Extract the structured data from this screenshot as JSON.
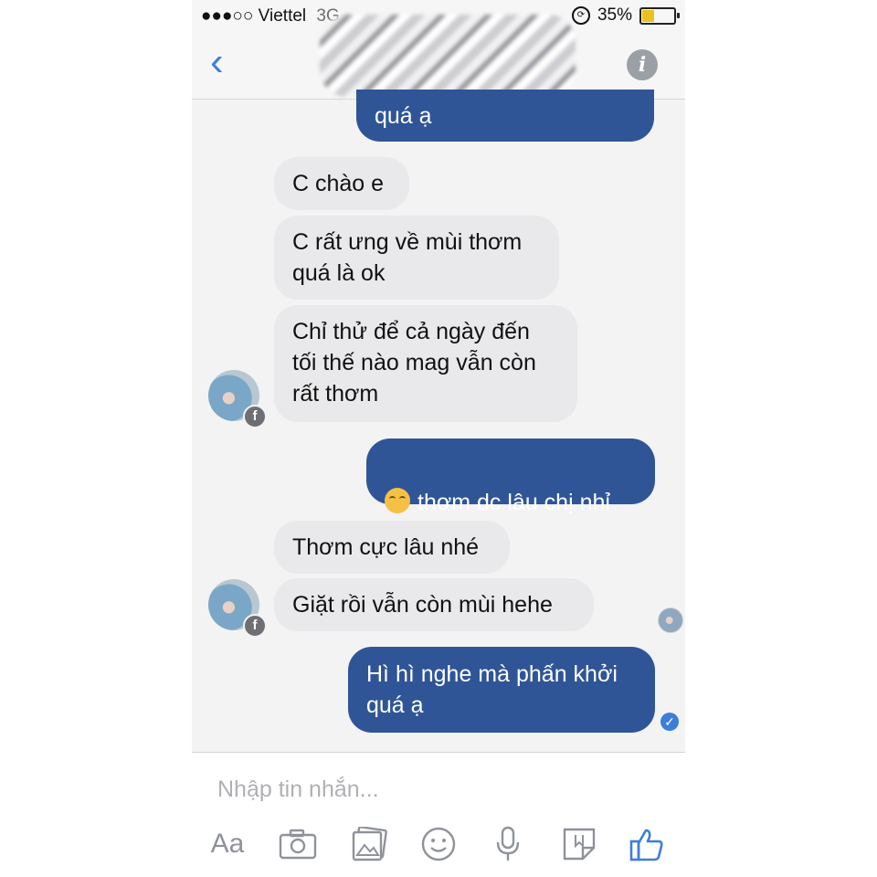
{
  "status_bar": {
    "signal": "●●●○○",
    "carrier": "Viettel",
    "network": "3G",
    "battery_percent": "35%",
    "battery_level": 0.35
  },
  "header": {
    "back_icon": "chevron-left-icon",
    "info_icon": "info-icon",
    "info_glyph": "i"
  },
  "messages": [
    {
      "side": "out",
      "text": "quá ạ"
    },
    {
      "side": "in",
      "text": "C chào e"
    },
    {
      "side": "in",
      "text": "C rất ưng về mùi thơm\nquá là ok"
    },
    {
      "side": "in",
      "text": "Chỉ thử để cả ngày đến\ntối thế nào mag vẫn còn\nrất thơm"
    },
    {
      "side": "out",
      "text": "thơm dc lâu chị nhỉ",
      "emoji": "smiling-face-icon"
    },
    {
      "side": "in",
      "text": "Thơm cực lâu nhé"
    },
    {
      "side": "in",
      "text": "Giặt rồi vẫn còn mùi hehe"
    },
    {
      "side": "out",
      "text": "Hì hì nghe mà phấn khởi\nquá ạ"
    }
  ],
  "badges": {
    "facebook_glyph": "f",
    "check_glyph": "✓"
  },
  "composer": {
    "placeholder": "Nhập tin nhắn...",
    "text_button": "Aa",
    "icons": [
      "text-format-icon",
      "camera-icon",
      "gallery-icon",
      "emoji-icon",
      "microphone-icon",
      "sticker-icon",
      "like-icon"
    ]
  },
  "colors": {
    "outgoing_bubble": "#2f5597",
    "incoming_bubble": "#e9e9eb",
    "accent": "#3e7ed9"
  }
}
